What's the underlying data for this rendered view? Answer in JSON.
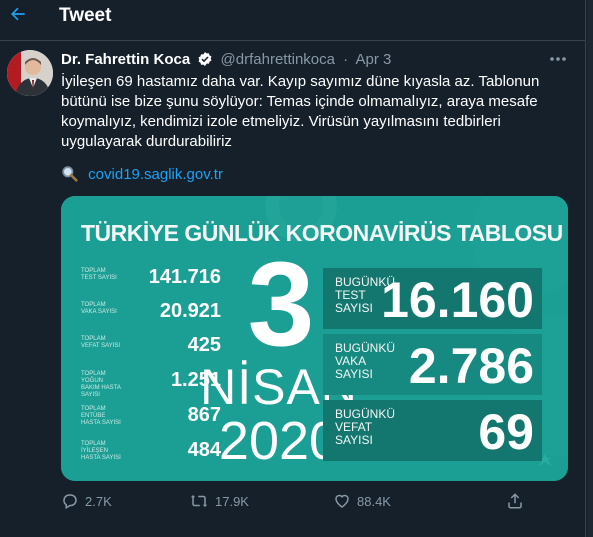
{
  "header": {
    "title": "Tweet",
    "back_icon": "back-arrow-icon"
  },
  "tweet": {
    "author_name": "Dr. Fahrettin Koca",
    "handle": "@drfahrettinkoca",
    "separator": "·",
    "date": "Apr 3",
    "more_icon": "more-horizontal-icon",
    "text": "İyileşen 69 hastamız daha var. Kayıp sayımız düne kıyasla az. Tablonun bütünü ise bize şunu söylüyor: Temas içinde olmamalıyız, araya mesafe koymalıyız, kendimizi izole etmeliyiz. Virüsün yayılmasını tedbirleri uygulayarak durdurabiliriz",
    "link_icon": "magnifier-icon",
    "link": "covid19.saglik.gov.tr"
  },
  "card": {
    "title": "TÜRKİYE GÜNLÜK KORONAVİRÜS TABLOSU",
    "colors": {
      "bg": "#1b9f94",
      "dark_box": "#14776f",
      "mid_box": "#168a80"
    },
    "stats": [
      {
        "label": "TOPLAM TEST SAYISI",
        "value": "141.716"
      },
      {
        "label": "TOPLAM VAKA SAYISI",
        "value": "20.921"
      },
      {
        "label": "TOPLAM VEFAT SAYISI",
        "value": "425"
      },
      {
        "label": "TOPLAM YOĞUN BAKIM HASTA SAYISI",
        "value": "1.251"
      },
      {
        "label": "TOPLAM ENTÜBE HASTA SAYISI",
        "value": "867"
      },
      {
        "label": "TOPLAM İYİLEŞEN HASTA SAYISI",
        "value": "484"
      }
    ],
    "day": "3",
    "month": "NİSAN",
    "year": "2020",
    "today": [
      {
        "label": "BUGÜNKÜ TEST SAYISI",
        "value": "16.160"
      },
      {
        "label": "BUGÜNKÜ VAKA SAYISI",
        "value": "2.786"
      },
      {
        "label": "BUGÜNKÜ VEFAT SAYISI",
        "value": "69"
      }
    ]
  },
  "actions": {
    "reply": {
      "icon": "reply-icon",
      "count": "2.7K"
    },
    "retweet": {
      "icon": "retweet-icon",
      "count": "17.9K"
    },
    "like": {
      "icon": "heart-icon",
      "count": "88.4K"
    },
    "share": {
      "icon": "share-icon"
    }
  }
}
